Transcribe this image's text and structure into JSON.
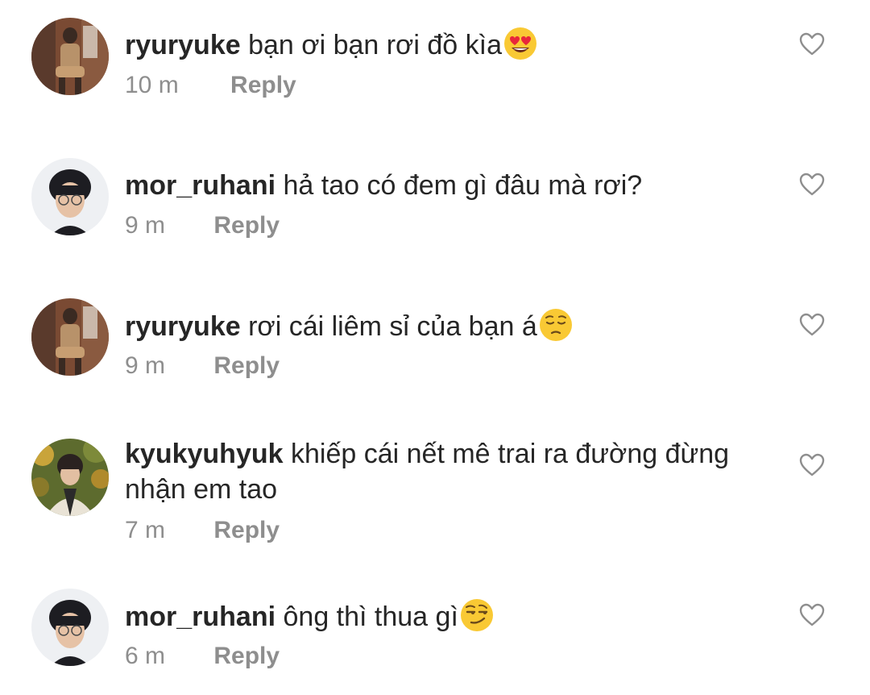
{
  "comments": [
    {
      "username": "ryuryuke",
      "text": "bạn ơi bạn rơi đồ kìa",
      "emoji": "heart-eyes-emoji",
      "time": "10 m",
      "reply": "Reply",
      "avatar": "avatar-ryuryuke"
    },
    {
      "username": "mor_ruhani",
      "text": "hả tao có đem gì đâu mà rơi?",
      "time": "9 m",
      "reply": "Reply",
      "avatar": "avatar-mor_ruhani"
    },
    {
      "username": "ryuryuke",
      "text": "rơi cái liêm sỉ của bạn á",
      "emoji": "pensive-face-emoji",
      "time": "9 m",
      "reply": "Reply",
      "avatar": "avatar-ryuryuke"
    },
    {
      "username": "kyukyuhyuk",
      "text": "khiếp cái nết mê trai ra đường đừng nhận em tao",
      "time": "7 m",
      "reply": "Reply",
      "avatar": "avatar-kyukyuhyuk"
    },
    {
      "username": "mor_ruhani",
      "text": "ông thì thua gì",
      "emoji": "smirking-face-emoji",
      "time": "6 m",
      "reply": "Reply",
      "avatar": "avatar-mor_ruhani"
    }
  ],
  "icons": {
    "like": "heart-outline-icon"
  },
  "colors": {
    "text": "#262626",
    "secondary": "#8e8e8e",
    "heart_outline": "#8e8e8e",
    "emoji_yellow": "#f9c934"
  }
}
